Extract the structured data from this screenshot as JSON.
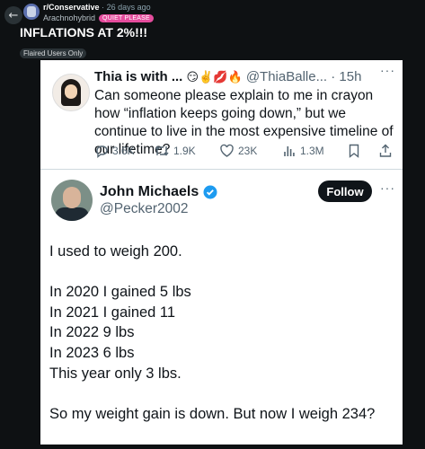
{
  "header": {
    "subreddit": "r/Conservative",
    "separator": "·",
    "time": "26 days ago",
    "username": "Arachnohybrid",
    "user_flair": "QUIET PLEASE",
    "flair_color": "#e54d9d"
  },
  "post": {
    "title": "INFLATIONS AT 2%!!!",
    "flair": "Flaired Users Only"
  },
  "quoted_tweet": {
    "name": "Thia is with ...",
    "emojis": "😏✌️💋🔥",
    "handle": "@ThiaBalle...",
    "separator": "·",
    "time": "15h",
    "text": "Can someone please explain to me in crayon how “inflation keeps going down,” but we continue to live in the most expensive timeline of our lifetime?",
    "stats": {
      "replies": "3.6K",
      "retweets": "1.9K",
      "likes": "23K",
      "views": "1.3M"
    }
  },
  "main_tweet": {
    "name": "John Michaels",
    "handle": "@Pecker2002",
    "follow_label": "Follow",
    "verified_color": "#1d9bf0",
    "lines": [
      "I used to weigh 200.",
      "In 2020 I gained 5 lbs",
      "In 2021 I gained 11",
      "In 2022 9 lbs",
      "In 2023 6 lbs",
      "This year only 3 lbs.",
      "So my weight gain is down. But now I weigh 234?"
    ]
  },
  "icons": {
    "back": "back-arrow-icon",
    "more": "more-icon"
  }
}
